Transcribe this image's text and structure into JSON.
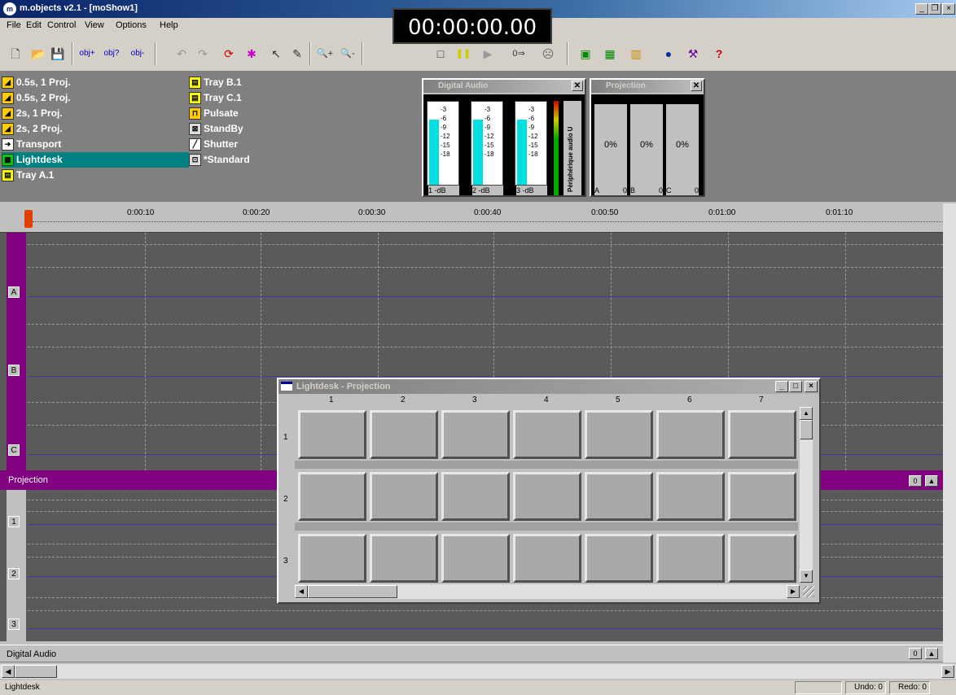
{
  "window": {
    "title": "m.objects v2.1 - [moShow1]"
  },
  "clock": {
    "time": "00:00:00.00"
  },
  "menu": [
    "File",
    "Edit",
    "Control",
    "View",
    "Options",
    "Help"
  ],
  "toolbar": {
    "icons": [
      "new-icon",
      "open-icon",
      "save-icon",
      "obj-add-icon",
      "obj-query-icon",
      "obj-edit-icon",
      "undo-icon",
      "redo-icon",
      "cycle-icon",
      "wheel-icon",
      "pointer-icon",
      "pen-icon",
      "zoom-in-icon",
      "zoom-out-icon",
      "stop-icon",
      "pause-icon",
      "play-icon",
      "goto-zero-icon",
      "comment-icon",
      "monitor-icon",
      "projector-icon",
      "lightdesk-icon",
      "effects-icon",
      "tools-icon",
      "help-icon"
    ],
    "glyphs": [
      "🗋",
      "📂",
      "💾",
      "obj+",
      "obj?",
      "obj-",
      "↶",
      "↷",
      "⟳",
      "✱",
      "↖",
      "✎",
      "🔍+",
      "🔍-",
      "□",
      "❚❚",
      "▶",
      "0⇒",
      "☹",
      "▣",
      "▦",
      "▥",
      "●",
      "⚒",
      "?"
    ]
  },
  "library": {
    "col1": [
      "0.5s, 1 Proj.",
      "0.5s, 2 Proj.",
      "2s, 1 Proj.",
      "2s, 2 Proj.",
      "Transport",
      "Lightdesk",
      "Tray A.1"
    ],
    "col2": [
      "Tray B.1",
      "Tray C.1",
      "Pulsate",
      "StandBy",
      "Shutter",
      "*Standard"
    ],
    "selected": "Lightdesk"
  },
  "digital_audio": {
    "title": "Digital Audio",
    "scale": [
      "-3",
      "-6",
      "-9",
      "-12",
      "-15",
      "-18"
    ],
    "channels": [
      {
        "num": "1",
        "unit": "-dB"
      },
      {
        "num": "2",
        "unit": "-dB"
      },
      {
        "num": "3",
        "unit": "-dB"
      }
    ],
    "side_label": "Périphérique audio U"
  },
  "projection_mini": {
    "title": "Projection",
    "channels": [
      {
        "pct": "0%",
        "id": "A",
        "val": "0"
      },
      {
        "pct": "0%",
        "id": "B",
        "val": "0"
      },
      {
        "pct": "0%",
        "id": "C",
        "val": "0"
      }
    ]
  },
  "timeline": {
    "ticks": [
      "0:00:10",
      "0:00:20",
      "0:00:30",
      "0:00:40",
      "0:00:50",
      "0:01:00",
      "0:01:10"
    ],
    "tracks": [
      "A",
      "B",
      "C"
    ]
  },
  "projection_track": {
    "label": "Projection",
    "rows": [
      "1",
      "2",
      "3"
    ],
    "btn1": "0",
    "btn2": "▲"
  },
  "audio_track": {
    "label": "Digital Audio",
    "btn1": "0",
    "btn2": "▲"
  },
  "lightdesk": {
    "title": "Lightdesk - Projection",
    "columns": [
      "1",
      "2",
      "3",
      "4",
      "5",
      "6",
      "7"
    ],
    "rows": [
      "1",
      "2",
      "3"
    ]
  },
  "status": {
    "left": "Lightdesk",
    "undo": "Undo: 0",
    "redo": "Redo: 0"
  }
}
